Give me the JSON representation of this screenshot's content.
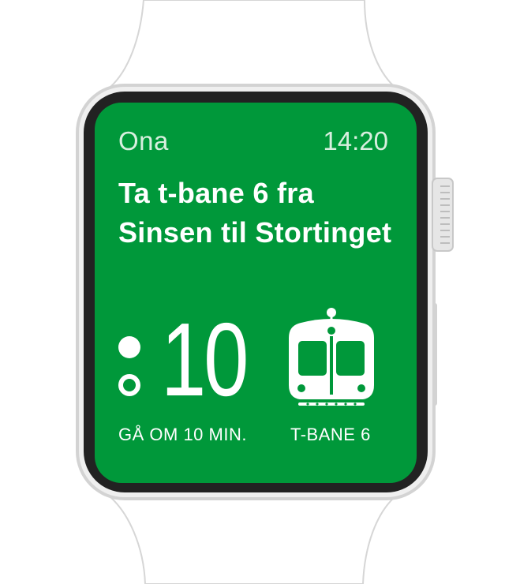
{
  "app": {
    "name": "Ona",
    "time": "14:20"
  },
  "instruction": {
    "title": "Ta t-bane 6 fra Sinsen til Stortinget"
  },
  "departure": {
    "minutes": "10",
    "caption": "GÅ OM 10 MIN.",
    "colon_icon": "departure-colon-icon"
  },
  "transport": {
    "icon": "metro-train-icon",
    "label": "T-BANE 6"
  },
  "colors": {
    "screen_background": "#00983a",
    "bezel": "#222222",
    "case": "#d3d3d3",
    "text": "#ffffff"
  }
}
